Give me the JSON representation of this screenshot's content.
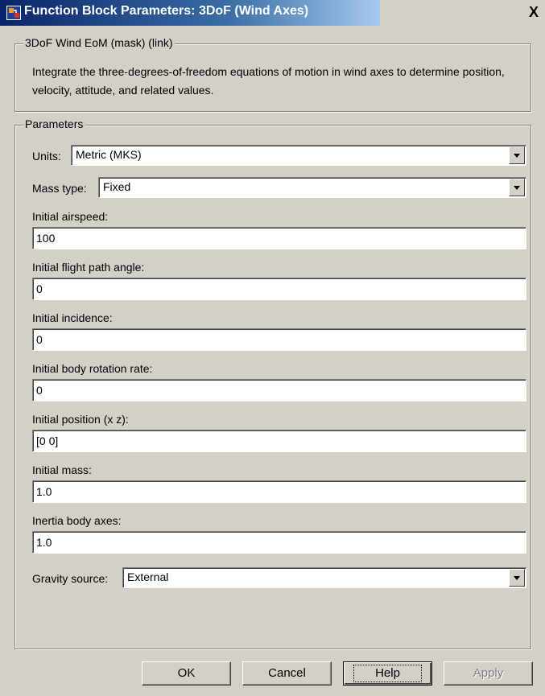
{
  "window": {
    "title": "Function Block Parameters: 3DoF (Wind Axes)",
    "close_glyph": "X",
    "icon": "simulink-block-icon"
  },
  "description_group": {
    "legend": "3DoF Wind EoM (mask) (link)",
    "text": "Integrate the three-degrees-of-freedom equations of motion in wind axes to determine position, velocity, attitude, and related values."
  },
  "parameters": {
    "legend": "Parameters",
    "units": {
      "label": "Units:",
      "value": "Metric (MKS)"
    },
    "mass_type": {
      "label": "Mass type:",
      "value": "Fixed"
    },
    "initial_airspeed": {
      "label": "Initial airspeed:",
      "value": "100"
    },
    "initial_flight_path_angle": {
      "label": "Initial flight path angle:",
      "value": "0"
    },
    "initial_incidence": {
      "label": "Initial incidence:",
      "value": "0"
    },
    "initial_body_rotation_rate": {
      "label": "Initial body rotation rate:",
      "value": "0"
    },
    "initial_position": {
      "label": "Initial position (x z):",
      "value": "[0 0]"
    },
    "initial_mass": {
      "label": "Initial mass:",
      "value": "1.0"
    },
    "inertia_body_axes": {
      "label": "Inertia body axes:",
      "value": "1.0"
    },
    "gravity_source": {
      "label": "Gravity source:",
      "value": "External"
    }
  },
  "buttons": {
    "ok": "OK",
    "cancel": "Cancel",
    "help": "Help",
    "apply": "Apply"
  },
  "colors": {
    "window_bg": "#d4d0c8",
    "titlebar_start": "#0a246a",
    "titlebar_end": "#a6caf0"
  }
}
